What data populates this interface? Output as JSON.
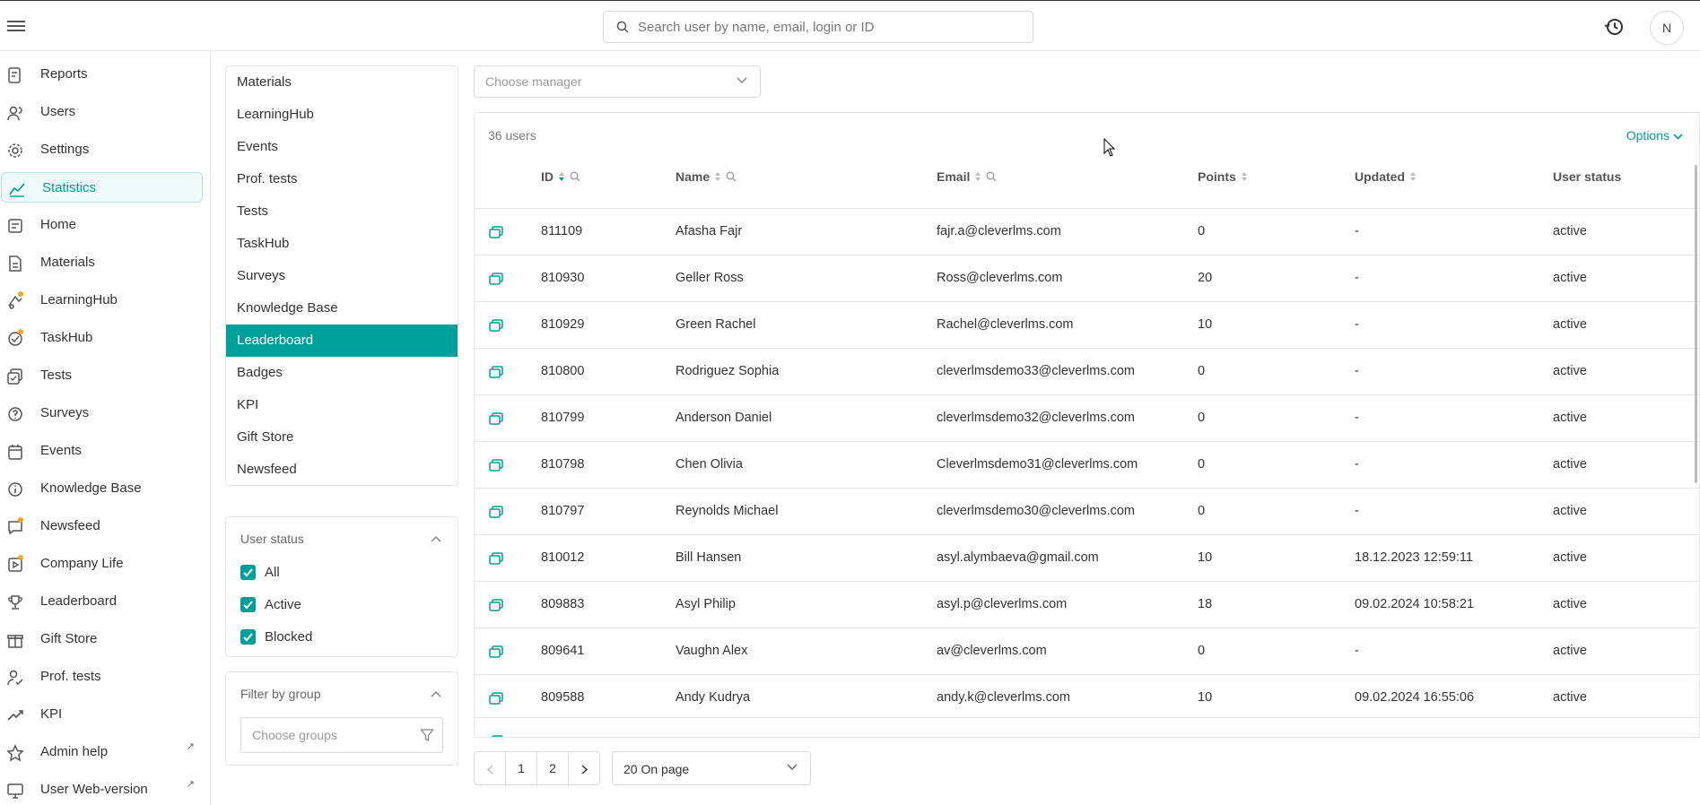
{
  "topbar": {
    "search_placeholder": "Search user by name, email, login or ID",
    "avatar_initial": "N"
  },
  "sidebar": {
    "items": [
      {
        "label": "Reports",
        "icon": "reports-icon"
      },
      {
        "label": "Users",
        "icon": "users-icon"
      },
      {
        "label": "Settings",
        "icon": "gear-icon"
      },
      {
        "label": "Statistics",
        "icon": "chart-line-icon",
        "active": true
      },
      {
        "label": "Home",
        "icon": "home-icon"
      },
      {
        "label": "Materials",
        "icon": "document-icon"
      },
      {
        "label": "LearningHub",
        "icon": "learninghub-icon"
      },
      {
        "label": "TaskHub",
        "icon": "taskhub-icon"
      },
      {
        "label": "Tests",
        "icon": "tests-icon"
      },
      {
        "label": "Surveys",
        "icon": "surveys-icon"
      },
      {
        "label": "Events",
        "icon": "calendar-icon"
      },
      {
        "label": "Knowledge Base",
        "icon": "info-icon"
      },
      {
        "label": "Newsfeed",
        "icon": "newsfeed-icon"
      },
      {
        "label": "Company Life",
        "icon": "company-life-icon"
      },
      {
        "label": "Leaderboard",
        "icon": "trophy-icon"
      },
      {
        "label": "Gift Store",
        "icon": "gift-icon"
      },
      {
        "label": "Prof. tests",
        "icon": "prof-tests-icon"
      },
      {
        "label": "KPI",
        "icon": "trend-icon"
      },
      {
        "label": "Admin help",
        "icon": "star-icon"
      },
      {
        "label": "User Web-version",
        "icon": "monitor-icon"
      }
    ],
    "external_mark": "↗"
  },
  "stats_menu": {
    "items": [
      "Materials",
      "LearningHub",
      "Events",
      "Prof. tests",
      "Tests",
      "TaskHub",
      "Surveys",
      "Knowledge Base",
      "Leaderboard",
      "Badges",
      "KPI",
      "Gift Store",
      "Newsfeed"
    ],
    "active": "Leaderboard"
  },
  "user_status": {
    "title": "User status",
    "options": [
      {
        "label": "All",
        "checked": true
      },
      {
        "label": "Active",
        "checked": true
      },
      {
        "label": "Blocked",
        "checked": true
      }
    ]
  },
  "group_filter": {
    "title": "Filter by group",
    "placeholder": "Choose groups"
  },
  "manager_select": {
    "placeholder": "Choose manager"
  },
  "table": {
    "count": "36 users",
    "options_label": "Options",
    "columns": [
      "ID",
      "Name",
      "Email",
      "Points",
      "Updated",
      "User status"
    ],
    "rows": [
      {
        "id": "811109",
        "name": "Afasha Fajr",
        "email": "fajr.a@cleverlms.com",
        "points": "0",
        "updated": "-",
        "status": "active"
      },
      {
        "id": "810930",
        "name": "Geller Ross",
        "email": "Ross@cleverlms.com",
        "points": "20",
        "updated": "-",
        "status": "active"
      },
      {
        "id": "810929",
        "name": "Green Rachel",
        "email": "Rachel@cleverlms.com",
        "points": "10",
        "updated": "-",
        "status": "active"
      },
      {
        "id": "810800",
        "name": "Rodriguez Sophia",
        "email": "cleverlmsdemo33@cleverlms.com",
        "points": "0",
        "updated": "-",
        "status": "active"
      },
      {
        "id": "810799",
        "name": "Anderson Daniel",
        "email": "cleverlmsdemo32@cleverlms.com",
        "points": "0",
        "updated": "-",
        "status": "active"
      },
      {
        "id": "810798",
        "name": "Chen Olivia",
        "email": "Cleverlmsdemo31@cleverlms.com",
        "points": "0",
        "updated": "-",
        "status": "active"
      },
      {
        "id": "810797",
        "name": "Reynolds Michael",
        "email": "cleverlmsdemo30@cleverlms.com",
        "points": "0",
        "updated": "-",
        "status": "active"
      },
      {
        "id": "810012",
        "name": "Bill Hansen",
        "email": "asyl.alymbaeva@gmail.com",
        "points": "10",
        "updated": "18.12.2023 12:59:11",
        "status": "active"
      },
      {
        "id": "809883",
        "name": "Asyl Philip",
        "email": "asyl.p@cleverlms.com",
        "points": "18",
        "updated": "09.02.2024 10:58:21",
        "status": "active"
      },
      {
        "id": "809641",
        "name": "Vaughn Alex",
        "email": "av@cleverlms.com",
        "points": "0",
        "updated": "-",
        "status": "active"
      },
      {
        "id": "809588",
        "name": "Andy Kudrya",
        "email": "andy.k@cleverlms.com",
        "points": "10",
        "updated": "09.02.2024 16:55:06",
        "status": "active"
      }
    ]
  },
  "pagination": {
    "pages": [
      "1",
      "2"
    ],
    "per_page": "20 On page"
  }
}
